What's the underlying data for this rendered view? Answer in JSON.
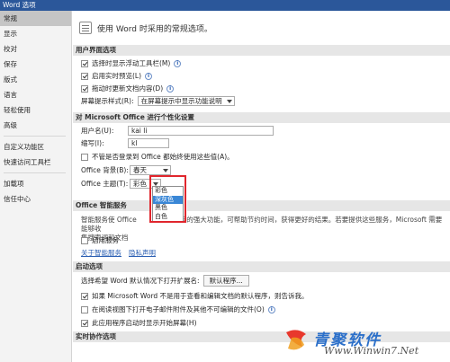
{
  "window": {
    "title": "Word 选项"
  },
  "sidebar": {
    "items": [
      {
        "label": "常规",
        "active": true
      },
      {
        "label": "显示"
      },
      {
        "label": "校对"
      },
      {
        "label": "保存"
      },
      {
        "label": "版式"
      },
      {
        "label": "语言"
      },
      {
        "label": "轻松使用"
      },
      {
        "label": "高级"
      }
    ],
    "items2": [
      {
        "label": "自定义功能区"
      },
      {
        "label": "快速访问工具栏"
      }
    ],
    "items3": [
      {
        "label": "加载项"
      },
      {
        "label": "信任中心"
      }
    ]
  },
  "main": {
    "heading": "使用 Word 时采用的常规选项。",
    "ui_section": {
      "title": "用户界面选项",
      "mini_toolbar": "选择时显示浮动工具栏(M)",
      "live_preview": "启用实时预览(L)",
      "drag_update": "拖动时更新文档内容(D)",
      "screentip_label": "屏幕提示样式(R):",
      "screentip_value": "在屏幕提示中显示功能说明"
    },
    "personalize_section": {
      "title": "对 Microsoft Office 进行个性化设置",
      "username_label": "用户名(U):",
      "username_value": "kai li",
      "initials_label": "缩写(I):",
      "initials_value": "kl",
      "always_use": "不管是否登录到 Office 都始终使用这些值(A)。",
      "background_label": "Office 背景(B):",
      "background_value": "春天",
      "theme_label": "Office 主题(T):",
      "theme_value": "彩色",
      "theme_options": [
        "彩色",
        "深灰色",
        "黑色",
        "白色"
      ]
    },
    "intelligent_section": {
      "title": "Office 智能服务",
      "desc_line1": "智能服务使 Office",
      "desc_line1b": "云的强大功能，可帮助节约时间，获得更好的结果。若要提供这些服务，Microsoft 需要能够收",
      "desc_line2": "集搜索词和文档",
      "enable": "启用服务",
      "about_link": "关于智能服务",
      "privacy_link": "隐私声明"
    },
    "startup_section": {
      "title": "启动选项",
      "default_label": "选择希望 Word 默认情况下打开扩展名:",
      "default_button": "默认程序...",
      "notify": "如果 Microsoft Word 不是用于查看和编辑文档的默认程序，则告诉我。",
      "reading_view": "在阅读视图下打开电子邮件附件及其他不可编辑的文件(O)",
      "start_screen": "此应用程序启动时显示开始屏幕(H)"
    },
    "coauthoring_section": {
      "title": "实时协作选项"
    }
  },
  "watermark": {
    "text1": "青聚软件",
    "text2": "Www.Winwin7.Net"
  }
}
